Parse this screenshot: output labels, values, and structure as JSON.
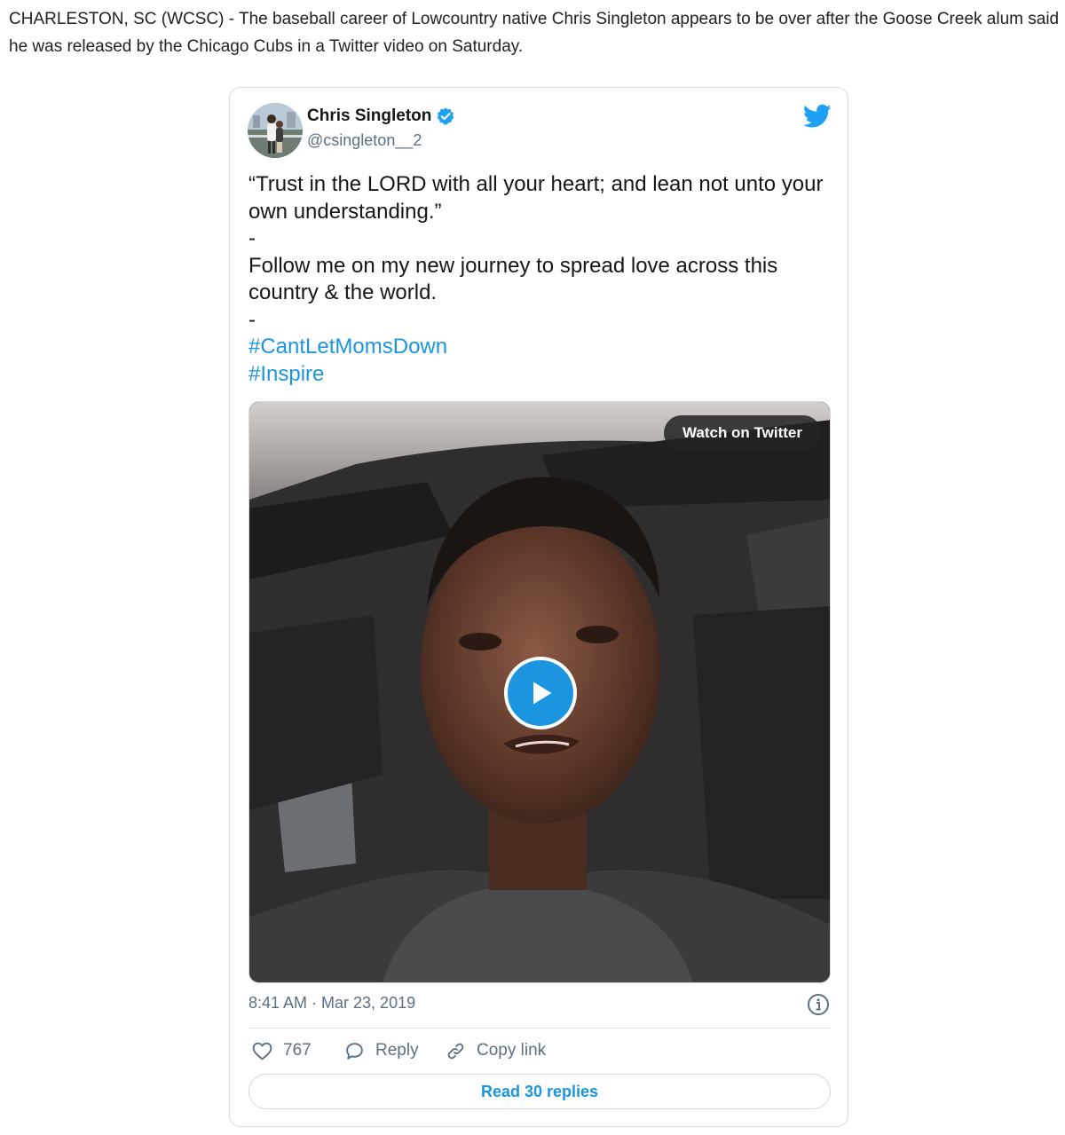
{
  "article": {
    "lede": "CHARLESTON, SC (WCSC) - The baseball career of Lowcountry native Chris Singleton appears to be over after the Goose Creek alum said he was released by the Chicago Cubs in a Twitter video on Saturday."
  },
  "tweet": {
    "author_name": "Chris Singleton",
    "author_handle": "@csingleton__2",
    "verified": true,
    "text_lines": [
      "“Trust in the LORD with all your heart; and lean not unto your own understanding.”",
      "-",
      "Follow me on my new journey to spread love across this country & the world.",
      "-"
    ],
    "hashtags": [
      "#CantLetMomsDown",
      "#Inspire"
    ],
    "media": {
      "watch_label": "Watch on Twitter",
      "play_icon": "play-icon"
    },
    "timestamp": "8:41 AM · Mar 23, 2019",
    "actions": {
      "like_count": "767",
      "reply_label": "Reply",
      "copy_label": "Copy link"
    },
    "read_replies_label": "Read 30 replies"
  },
  "icons": {
    "brand": "twitter-bird-icon",
    "verified": "verified-badge-icon",
    "like": "heart-icon",
    "reply": "speech-bubble-icon",
    "copy": "link-icon",
    "info": "info-icon"
  },
  "colors": {
    "twitter_blue": "#1b95e0",
    "secondary_text": "#5b7083",
    "border": "#d8dde1"
  }
}
